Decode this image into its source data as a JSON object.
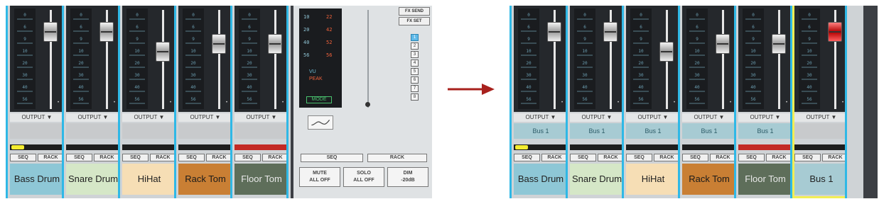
{
  "left_panel": {
    "channels": [
      {
        "name": "Bass Drum",
        "color": "#8ec7d6",
        "text_color": "#222222",
        "fader": 0.85,
        "color_tag": "yellow"
      },
      {
        "name": "Snare Drum",
        "color": "#d5e7c7",
        "text_color": "#222222",
        "fader": 0.85,
        "color_tag": "none"
      },
      {
        "name": "HiHat",
        "color": "#f6deb5",
        "text_color": "#222222",
        "fader": 0.6,
        "color_tag": "none"
      },
      {
        "name": "Rack Tom",
        "color": "#c97f34",
        "text_color": "#1a1a1a",
        "fader": 0.7,
        "color_tag": "none"
      },
      {
        "name": "Floor Tom",
        "color": "#5e6e5a",
        "text_color": "#e8e8e8",
        "fader": 0.7,
        "color_tag": "red"
      }
    ],
    "output_label": "OUTPUT ▼",
    "seq_label": "SEQ",
    "rack_label": "RACK"
  },
  "master": {
    "vu_left_ticks": [
      "10",
      "20",
      "40",
      "56"
    ],
    "vu_right_ticks": [
      "22",
      "42",
      "52",
      "56"
    ],
    "vu_label": "VU",
    "peak_label": "PEAK",
    "mode_label": "MODE",
    "fx_send": "FX SEND",
    "fx_set": "FX SET",
    "fx_numbers": [
      "1",
      "2",
      "3",
      "4",
      "5",
      "6",
      "7",
      "8"
    ],
    "active_fx": "1",
    "seq_label": "SEQ",
    "rack_label": "RACK",
    "mute_label_1": "MUTE",
    "mute_label_2": "ALL OFF",
    "solo_label_1": "SOLO",
    "solo_label_2": "ALL OFF",
    "dim_label_1": "DIM",
    "dim_label_2": "-20dB"
  },
  "right_panel": {
    "channels": [
      {
        "name": "Bass Drum",
        "bus": "Bus 1",
        "color": "#8ec7d6",
        "text_color": "#222222",
        "fader": 0.85,
        "color_tag": "yellow"
      },
      {
        "name": "Snare Drum",
        "bus": "Bus 1",
        "color": "#d5e7c7",
        "text_color": "#222222",
        "fader": 0.85,
        "color_tag": "none"
      },
      {
        "name": "HiHat",
        "bus": "Bus 1",
        "color": "#f6deb5",
        "text_color": "#222222",
        "fader": 0.6,
        "color_tag": "none"
      },
      {
        "name": "Rack Tom",
        "bus": "Bus 1",
        "color": "#c97f34",
        "text_color": "#1a1a1a",
        "fader": 0.7,
        "color_tag": "none"
      },
      {
        "name": "Floor Tom",
        "bus": "Bus 1",
        "color": "#5e6e5a",
        "text_color": "#e8e8e8",
        "fader": 0.7,
        "color_tag": "red"
      },
      {
        "name": "Bus 1",
        "bus": "",
        "color": "#a7cbd3",
        "text_color": "#222222",
        "fader": 0.85,
        "color_tag": "none",
        "selected": true,
        "red_fader": true
      }
    ],
    "output_label": "OUTPUT ▼",
    "seq_label": "SEQ",
    "rack_label": "RACK"
  },
  "meter_ticks": [
    "0",
    "6",
    "9",
    "10",
    "20",
    "30",
    "40",
    "56"
  ],
  "arrow_color": "#a8211d"
}
